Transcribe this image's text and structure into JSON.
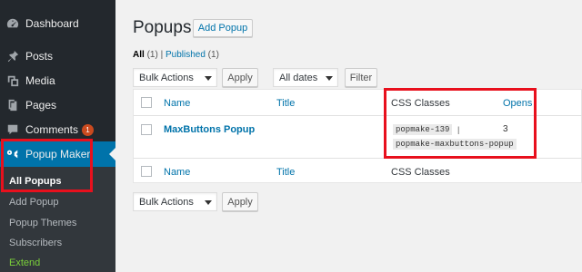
{
  "sidebar": {
    "dashboard": "Dashboard",
    "posts": "Posts",
    "media": "Media",
    "pages": "Pages",
    "comments": "Comments",
    "comments_badge": "1",
    "popup_maker": "Popup Maker",
    "submenu": [
      "All Popups",
      "Add Popup",
      "Popup Themes",
      "Subscribers",
      "Extend"
    ]
  },
  "main": {
    "title": "Popups",
    "add_button": "Add Popup",
    "filters": {
      "all_label": "All",
      "all_count": "(1)",
      "separator": "|",
      "published_label": "Published",
      "published_count": "(1)"
    },
    "bulk_actions": "Bulk Actions",
    "apply": "Apply",
    "dates": "All dates",
    "filter_button": "Filter",
    "table": {
      "columns": [
        "Name",
        "Title",
        "CSS Classes",
        "Opens"
      ],
      "rows": [
        {
          "name": "MaxButtons Popup",
          "css_classes": [
            "popmake-139",
            "popmake-maxbuttons-popup"
          ],
          "css_separator": "|",
          "opens": "3"
        }
      ]
    }
  },
  "colors": {
    "sidebar_bg": "#23282d",
    "active_bg": "#0073aa",
    "link": "#0073aa",
    "highlight": "#e8101d",
    "badge": "#ca4a1f",
    "extend": "#7ad03a"
  }
}
